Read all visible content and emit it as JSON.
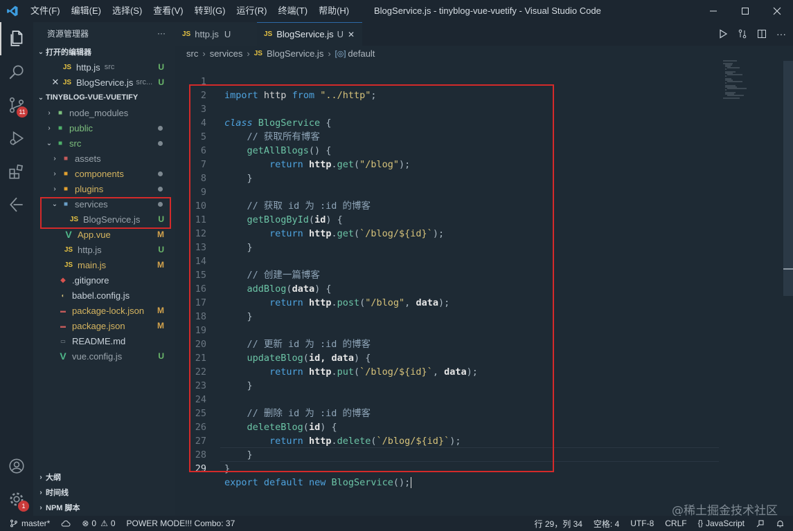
{
  "titlebar": {
    "menu": [
      "文件(F)",
      "编辑(E)",
      "选择(S)",
      "查看(V)",
      "转到(G)",
      "运行(R)",
      "终端(T)",
      "帮助(H)"
    ],
    "window_title": "BlogService.js - tinyblog-vue-vuetify - Visual Studio Code"
  },
  "activity": {
    "scm_badge": "11",
    "settings_badge": "1"
  },
  "sidebar": {
    "title": "资源管理器",
    "more": "···",
    "open_editors_label": "打开的编辑器",
    "open_editors": [
      {
        "name": "http.js",
        "path": "src",
        "status": "U"
      },
      {
        "name": "BlogService.js",
        "path": "src...",
        "status": "U"
      }
    ],
    "project_label": "TINYBLOG-VUE-VUETIFY",
    "tree": [
      {
        "name": "node_modules",
        "status": ""
      },
      {
        "name": "public",
        "status": "dot"
      },
      {
        "name": "src",
        "status": "dot"
      },
      {
        "name": "assets",
        "status": ""
      },
      {
        "name": "components",
        "status": "dot"
      },
      {
        "name": "plugins",
        "status": "dot"
      },
      {
        "name": "services",
        "status": "dot"
      },
      {
        "name": "BlogService.js",
        "status": "U"
      },
      {
        "name": "App.vue",
        "status": "M"
      },
      {
        "name": "http.js",
        "status": "U"
      },
      {
        "name": "main.js",
        "status": "M"
      },
      {
        "name": ".gitignore",
        "status": ""
      },
      {
        "name": "babel.config.js",
        "status": ""
      },
      {
        "name": "package-lock.json",
        "status": "M"
      },
      {
        "name": "package.json",
        "status": "M"
      },
      {
        "name": "README.md",
        "status": ""
      },
      {
        "name": "vue.config.js",
        "status": "U"
      }
    ],
    "bottom_sections": [
      "大纲",
      "时间线",
      "NPM 脚本"
    ]
  },
  "tabs": [
    {
      "label": "http.js",
      "status": "U",
      "active": false
    },
    {
      "label": "BlogService.js",
      "status": "U",
      "active": true
    }
  ],
  "tab_close": "✕",
  "breadcrumb": {
    "parts": [
      "src",
      "services",
      "BlogService.js",
      "default"
    ]
  },
  "editor": {
    "lines": [
      {
        "n": "1"
      },
      {
        "n": "2"
      },
      {
        "n": "3"
      },
      {
        "n": "4"
      },
      {
        "n": "5"
      },
      {
        "n": "6"
      },
      {
        "n": "7"
      },
      {
        "n": "8"
      },
      {
        "n": "9"
      },
      {
        "n": "10"
      },
      {
        "n": "11"
      },
      {
        "n": "12"
      },
      {
        "n": "13"
      },
      {
        "n": "14"
      },
      {
        "n": "15"
      },
      {
        "n": "16"
      },
      {
        "n": "17"
      },
      {
        "n": "18"
      },
      {
        "n": "19"
      },
      {
        "n": "20"
      },
      {
        "n": "21"
      },
      {
        "n": "22"
      },
      {
        "n": "23"
      },
      {
        "n": "24"
      },
      {
        "n": "25"
      },
      {
        "n": "26"
      },
      {
        "n": "27"
      },
      {
        "n": "28"
      },
      {
        "n": "29"
      }
    ],
    "code": {
      "l1_import": "import",
      "l1_http": "http",
      "l1_from": "from",
      "l1_path": "\"../http\"",
      "l3_class": "class",
      "l3_name": "BlogService",
      "l4_comment": "// 获取所有博客",
      "l5_fn": "getAllBlogs",
      "l6_return": "return",
      "l6_http": "http",
      "l6_get": "get",
      "l6_str": "\"/blog\"",
      "l9_comment": "// 获取 id 为 :id 的博客",
      "l10_fn": "getBlogById",
      "l10_param": "id",
      "l11_str": "`/blog/${id}`",
      "l14_comment": "// 创建一篇博客",
      "l15_fn": "addBlog",
      "l15_param": "data",
      "l16_post": "post",
      "l19_comment": "// 更新 id 为 :id 的博客",
      "l20_fn": "updateBlog",
      "l20_params": "id, data",
      "l21_put": "put",
      "l24_comment": "// 删除 id 为 :id 的博客",
      "l25_fn": "deleteBlog",
      "l26_delete": "delete",
      "l29_export": "export",
      "l29_default": "default",
      "l29_new": "new",
      "l29_call": "BlogService"
    }
  },
  "watermark": "@稀土掘金技术社区",
  "statusbar": {
    "branch": "master*",
    "errors": "0",
    "warnings": "0",
    "power_mode": "POWER MODE!!! Combo: 37",
    "position": "行 29，列 34",
    "spaces": "空格: 4",
    "encoding": "UTF-8",
    "eol": "CRLF",
    "language": "JavaScript"
  }
}
